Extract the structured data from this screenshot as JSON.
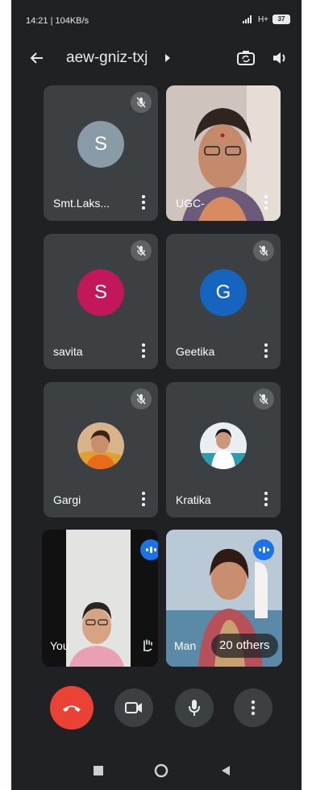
{
  "status": {
    "time_speed": "14:21 | 104KB/s",
    "network": "H+",
    "battery": "37"
  },
  "header": {
    "title": "aew-gniz-txj"
  },
  "participants": [
    {
      "name": "Smt.Laks...",
      "initial": "S",
      "avatar_color": "#8a9ba8",
      "muted": true
    },
    {
      "name": "UGC-",
      "video": true,
      "muted": false
    },
    {
      "name": "savita",
      "initial": "S",
      "avatar_color": "#c2185b",
      "muted": true
    },
    {
      "name": "Geetika",
      "initial": "G",
      "avatar_color": "#1565c0",
      "muted": true
    },
    {
      "name": "Gargi",
      "photo": true,
      "muted": true
    },
    {
      "name": "Kratika",
      "photo": true,
      "muted": true
    },
    {
      "name": "You",
      "video": true,
      "speaking": true
    },
    {
      "name": "Man",
      "video": true,
      "speaking": true
    }
  ],
  "others_count": "20 others",
  "colors": {
    "end_call": "#ea4335",
    "speaking": "#1a73e8",
    "tile_bg": "#3c4043",
    "screen_bg": "#202124"
  },
  "icons": {
    "back": "arrow-left-icon",
    "caret": "caret-right-icon",
    "switch_camera": "switch-camera-icon",
    "speaker": "speaker-icon",
    "mute": "mic-off-icon",
    "more": "more-vert-icon",
    "end_call": "call-end-icon",
    "camera": "videocam-icon",
    "mic": "mic-icon",
    "raise_hand": "hand-icon",
    "nav": [
      "square-icon",
      "circle-icon",
      "triangle-back-icon"
    ]
  }
}
